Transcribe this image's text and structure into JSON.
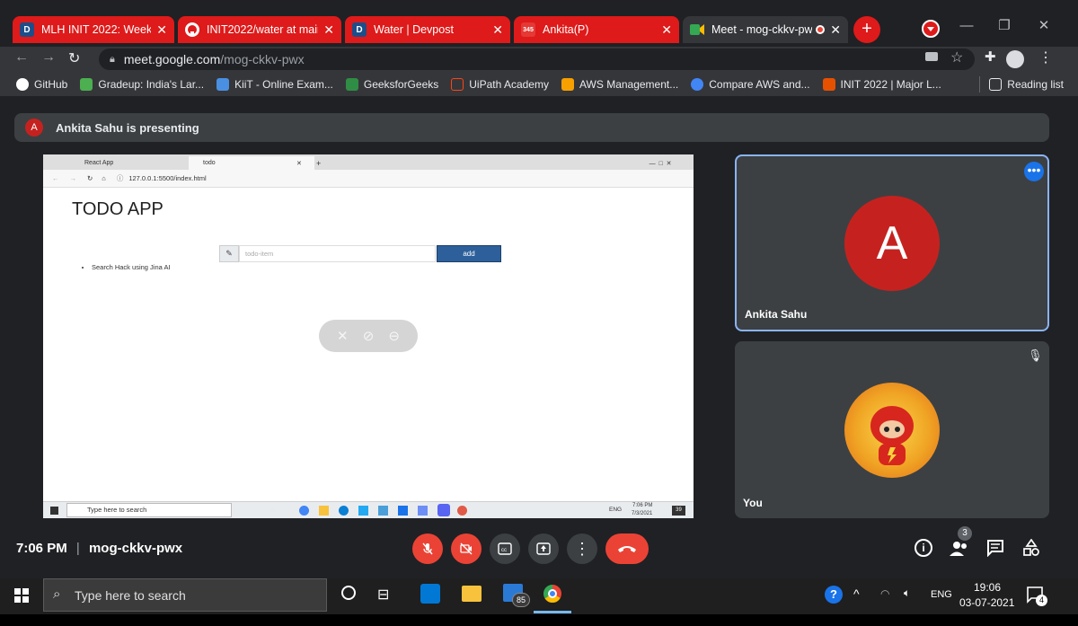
{
  "tabs": [
    {
      "title": "MLH INIT 2022: Weekend",
      "fav": "D",
      "fav_color": "#1d4e89"
    },
    {
      "title": "INIT2022/water at main · i",
      "fav": "",
      "fav_color": "#ffffff"
    },
    {
      "title": "Water | Devpost",
      "fav": "D",
      "fav_color": "#1d4e89"
    },
    {
      "title": "Ankita(P)",
      "fav": "345",
      "fav_color": "#e53935"
    },
    {
      "title": "Meet - mog-ckkv-pw",
      "fav": "",
      "fav_color": "#34a853"
    }
  ],
  "toolbar": {
    "url_host": "meet.google.com",
    "url_path": "/mog-ckkv-pwx"
  },
  "bookmarks": [
    {
      "label": "GitHub"
    },
    {
      "label": "Gradeup: India's Lar..."
    },
    {
      "label": "KiiT - Online Exam..."
    },
    {
      "label": "GeeksforGeeks"
    },
    {
      "label": "UiPath Academy"
    },
    {
      "label": "AWS Management..."
    },
    {
      "label": "Compare AWS and..."
    },
    {
      "label": "INIT 2022 | Major L..."
    }
  ],
  "reading_list": "Reading list",
  "presenting": {
    "avatar": "A",
    "text": "Ankita Sahu is presenting"
  },
  "shared_screen": {
    "tabs": [
      "React App",
      "todo"
    ],
    "url": "127.0.0.1:5500/index.html",
    "app_title": "TODO APP",
    "input_placeholder": "todo-item",
    "add_label": "add",
    "items": [
      "Search Hack using Jina AI"
    ],
    "taskbar_search": "Type here to search",
    "time": "7:06 PM",
    "date": "7/3/2021",
    "lang": "ENG",
    "badge": "39"
  },
  "participants": [
    {
      "name": "Ankita Sahu",
      "avatar": "A",
      "avatar_color": "#c5221f"
    },
    {
      "name": "You"
    }
  ],
  "meeting": {
    "time": "7:06 PM",
    "separator": "|",
    "code": "mog-ckkv-pwx",
    "people_count": "3"
  },
  "taskbar": {
    "search": "Type here to search",
    "mail_badge": "85",
    "lang": "ENG",
    "time": "19:06",
    "date": "03-07-2021",
    "notif": "4"
  },
  "colors": {
    "chrome_red": "#DE1A1A",
    "meet_red": "#ea4335",
    "accent_blue": "#8ab4f8"
  }
}
